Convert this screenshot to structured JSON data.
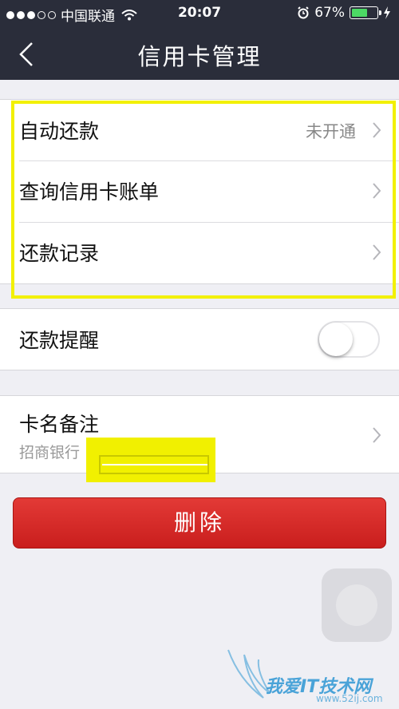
{
  "status_bar": {
    "carrier": "中国联通",
    "time": "20:07",
    "battery": "67%",
    "battery_level": 0.67
  },
  "nav": {
    "title": "信用卡管理"
  },
  "repayment_group": {
    "items": [
      {
        "label": "自动还款",
        "value": "未开通"
      },
      {
        "label": "查询信用卡账单"
      },
      {
        "label": "还款记录"
      }
    ]
  },
  "reminder": {
    "label": "还款提醒",
    "enabled": false
  },
  "card_note": {
    "label": "卡名备注",
    "sub": "招商银行"
  },
  "delete_button": {
    "label": "删除"
  },
  "watermark": {
    "text": "我爱IT技术网",
    "url": "www.52ij.com"
  },
  "colors": {
    "nav_bg": "#2a2d3a",
    "danger": "#d62a28",
    "highlight": "#f2f000",
    "battery_green": "#4cd964"
  }
}
